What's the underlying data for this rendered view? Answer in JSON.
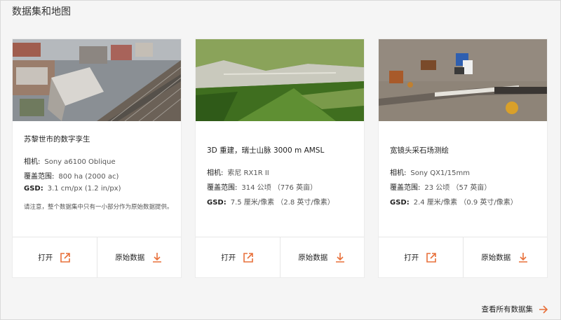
{
  "section_title": "数据集和地图",
  "accent_color": "#e8703a",
  "cards": [
    {
      "title": "苏黎世市的数字孪生",
      "image": "zurich-city-aerial-photo",
      "specs": [
        {
          "label": "相机:",
          "value": "Sony a6100 Oblique"
        },
        {
          "label": "覆盖范围:",
          "value": "800 ha (2000 ac)"
        },
        {
          "label": "GSD:",
          "value": "3.1 cm/px (1.2 in/px)"
        }
      ],
      "note": "请注意，整个数据集中只有一小部分作为原始数据提供。",
      "open_label": "打开",
      "raw_label": "原始数据"
    },
    {
      "title": "3D 重建，瑞士山脉 3000 m AMSL",
      "image": "swiss-mountain-3d-photo",
      "specs": [
        {
          "label": "相机:",
          "value": "索尼 RX1R II"
        },
        {
          "label": "覆盖范围:",
          "value": "314 公顷 （776 英亩）"
        },
        {
          "label": "GSD:",
          "value": "7.5 厘米/像素 （2.8 英寸/像素）"
        }
      ],
      "open_label": "打开",
      "raw_label": "原始数据"
    },
    {
      "title": "宽镜头采石场测绘",
      "image": "quarry-aerial-photo",
      "specs": [
        {
          "label": "相机:",
          "value": "Sony QX1/15mm"
        },
        {
          "label": "覆盖范围:",
          "value": "23 公顷 （57 英亩）"
        },
        {
          "label": "GSD:",
          "value": "2.4 厘米/像素 （0.9 英寸/像素）"
        }
      ],
      "open_label": "打开",
      "raw_label": "原始数据"
    }
  ],
  "view_all_label": "查看所有数据集"
}
